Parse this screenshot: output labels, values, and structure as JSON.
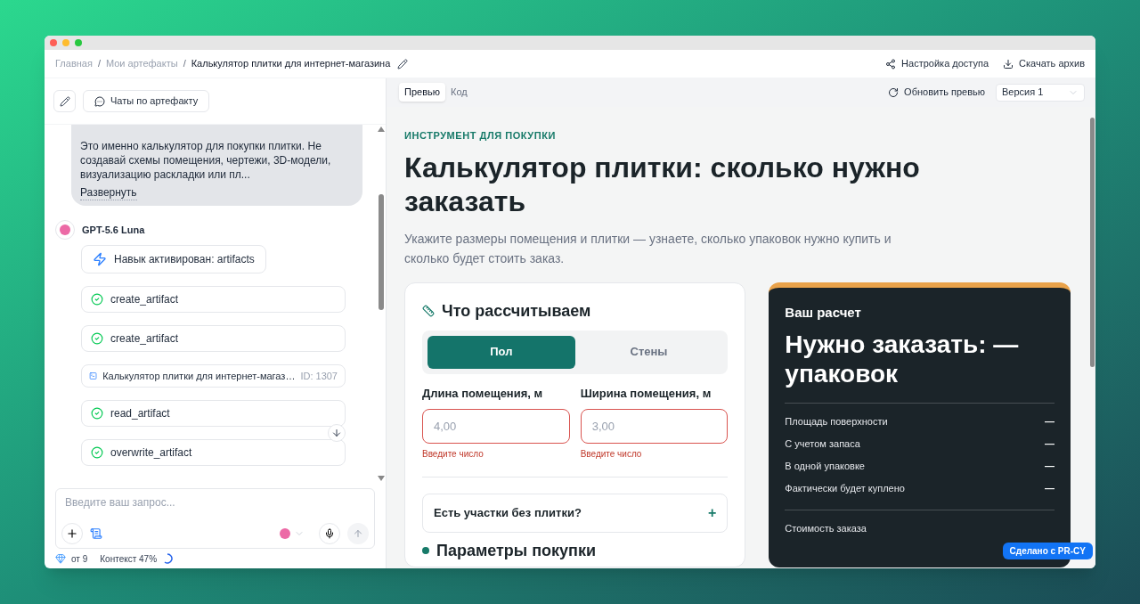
{
  "breadcrumbs": [
    {
      "label": "Главная",
      "current": false
    },
    {
      "separator": "/",
      "label": "Мои артефакты",
      "current": false
    },
    {
      "separator": "/",
      "label": "Калькулятор плитки для интернет-магазина",
      "current": true
    }
  ],
  "header_actions": [
    {
      "kind": "share",
      "label": "Настройка доступа"
    },
    {
      "kind": "download",
      "label": "Скачать архив"
    }
  ],
  "chat_toolbar": {
    "chats_button": "Чаты по артефакту"
  },
  "user_message": {
    "text": "Это именно калькулятор для покупки плитки. Не создавай схемы помещения, чертежи, 3D-модели, визуализацию раскладки или пл...",
    "expand_link": "Развернуть"
  },
  "assistant": {
    "name": "GPT-5.6 Luna",
    "steps": [
      {
        "kind": "skill",
        "label": "Навык активирован: artifacts"
      },
      {
        "kind": "tool",
        "label": "create_artifact"
      },
      {
        "kind": "tool",
        "label": "create_artifact"
      },
      {
        "kind": "artifact",
        "label": "Калькулятор плитки для интернет-магаз…",
        "id": "ID: 1307"
      },
      {
        "kind": "tool",
        "label": "read_artifact"
      },
      {
        "kind": "tool",
        "label": "overwrite_artifact"
      }
    ]
  },
  "composer": {
    "placeholder": "Введите ваш запрос..."
  },
  "footer": {
    "credits": "от 9",
    "context": "Контекст 47%"
  },
  "preview_tabs": [
    {
      "label": "Превью",
      "selected": true
    },
    {
      "label": "Код",
      "selected": false
    }
  ],
  "refresh_button": "Обновить превью",
  "version_select": "Версия 1",
  "page": {
    "eyebrow": "ИНСТРУМЕНТ ДЛЯ ПОКУПКИ",
    "title": "Калькулятор плитки: сколько нужно заказать",
    "subtitle": "Укажите размеры помещения и плитки — узнаете, сколько упаковок нужно купить и сколько будет стоить заказ.",
    "form_card": {
      "heading": "Что рассчитываем",
      "surface_options": [
        {
          "label": "Пол",
          "selected": true
        },
        {
          "label": "Стены",
          "selected": false
        }
      ],
      "fields": [
        {
          "label": "Длина помещения, м",
          "placeholder": "4,00",
          "invalid": true,
          "error": "Введите число"
        },
        {
          "label": "Ширина помещения, м",
          "placeholder": "3,00",
          "invalid": true,
          "error": "Введите число"
        }
      ],
      "accordion": {
        "label": "Есть участки без плитки?",
        "expanded": false,
        "icon": "+"
      },
      "next_heading": "Параметры покупки"
    },
    "result_card": {
      "caption": "Ваш расчет",
      "headline": "Нужно заказать: — упаковок",
      "rows": [
        {
          "label": "Площадь поверхности",
          "value": "—"
        },
        {
          "label": "С учетом запаса",
          "value": "—"
        },
        {
          "label": "В одной упаковке",
          "value": "—"
        },
        {
          "label": "Фактически будет куплено",
          "value": "—"
        }
      ],
      "total_label": "Стоимость заказа"
    }
  },
  "made_with_badge": "Сделано с PR-CY"
}
